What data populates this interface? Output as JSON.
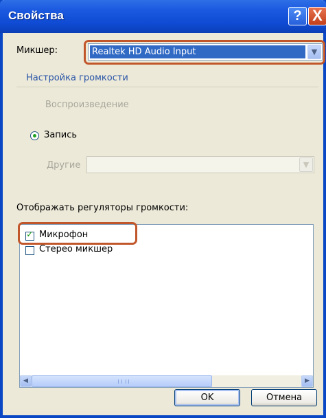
{
  "window": {
    "title": "Свойства"
  },
  "titlebar": {
    "help_label": "?",
    "close_label": "X"
  },
  "mixer": {
    "label": "Микшер:",
    "selected": "Realtek HD Audio Input"
  },
  "volume_settings": {
    "header": "Настройка громкости",
    "playback_label": "Воспроизведение",
    "record_label": "Запись",
    "other_label": "Другие"
  },
  "controls": {
    "label": "Отображать регуляторы громкости:",
    "items": [
      {
        "label": "Микрофон",
        "checked": true
      },
      {
        "label": "Стерео микшер",
        "checked": false
      }
    ]
  },
  "buttons": {
    "ok": "OK",
    "cancel": "Отмена"
  },
  "colors": {
    "accent": "#c2562b",
    "titlebar": "#0f4bd4"
  }
}
